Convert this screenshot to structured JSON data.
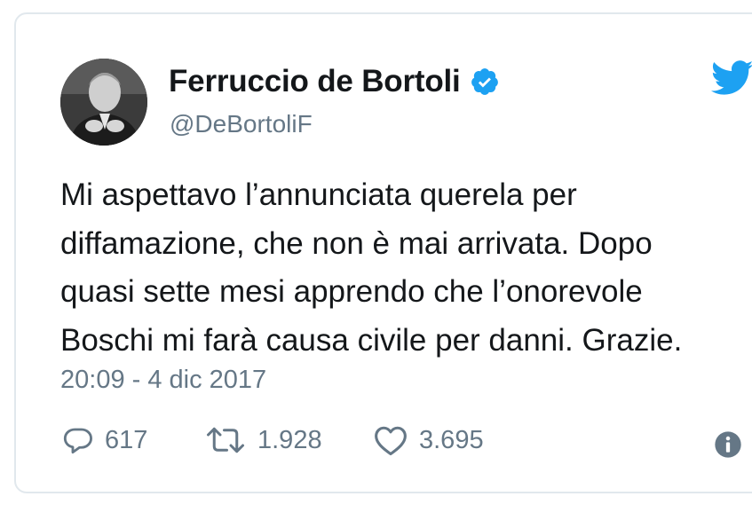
{
  "author": {
    "name": "Ferruccio de Bortoli",
    "handle": "@DeBortoliF",
    "verified": true,
    "avatar_icon": "profile-photo"
  },
  "tweet": {
    "text": "Mi aspettavo l’annunciata querela per\ndiffamazione, che non è mai arrivata. Dopo\nquasi sette mesi apprendo che l’onorevole\nBoschi mi farà causa civile per danni. Grazie.",
    "timestamp": "20:09 - 4 dic 2017"
  },
  "actions": {
    "replies": "617",
    "retweets": "1.928",
    "likes": "3.695"
  },
  "colors": {
    "twitter_blue": "#1da1f2",
    "text": "#14171a",
    "secondary": "#657786",
    "border": "#e1e8ed"
  },
  "icons": [
    "twitter-bird-icon",
    "verified-badge-icon",
    "reply-icon",
    "retweet-icon",
    "like-icon",
    "info-icon"
  ]
}
